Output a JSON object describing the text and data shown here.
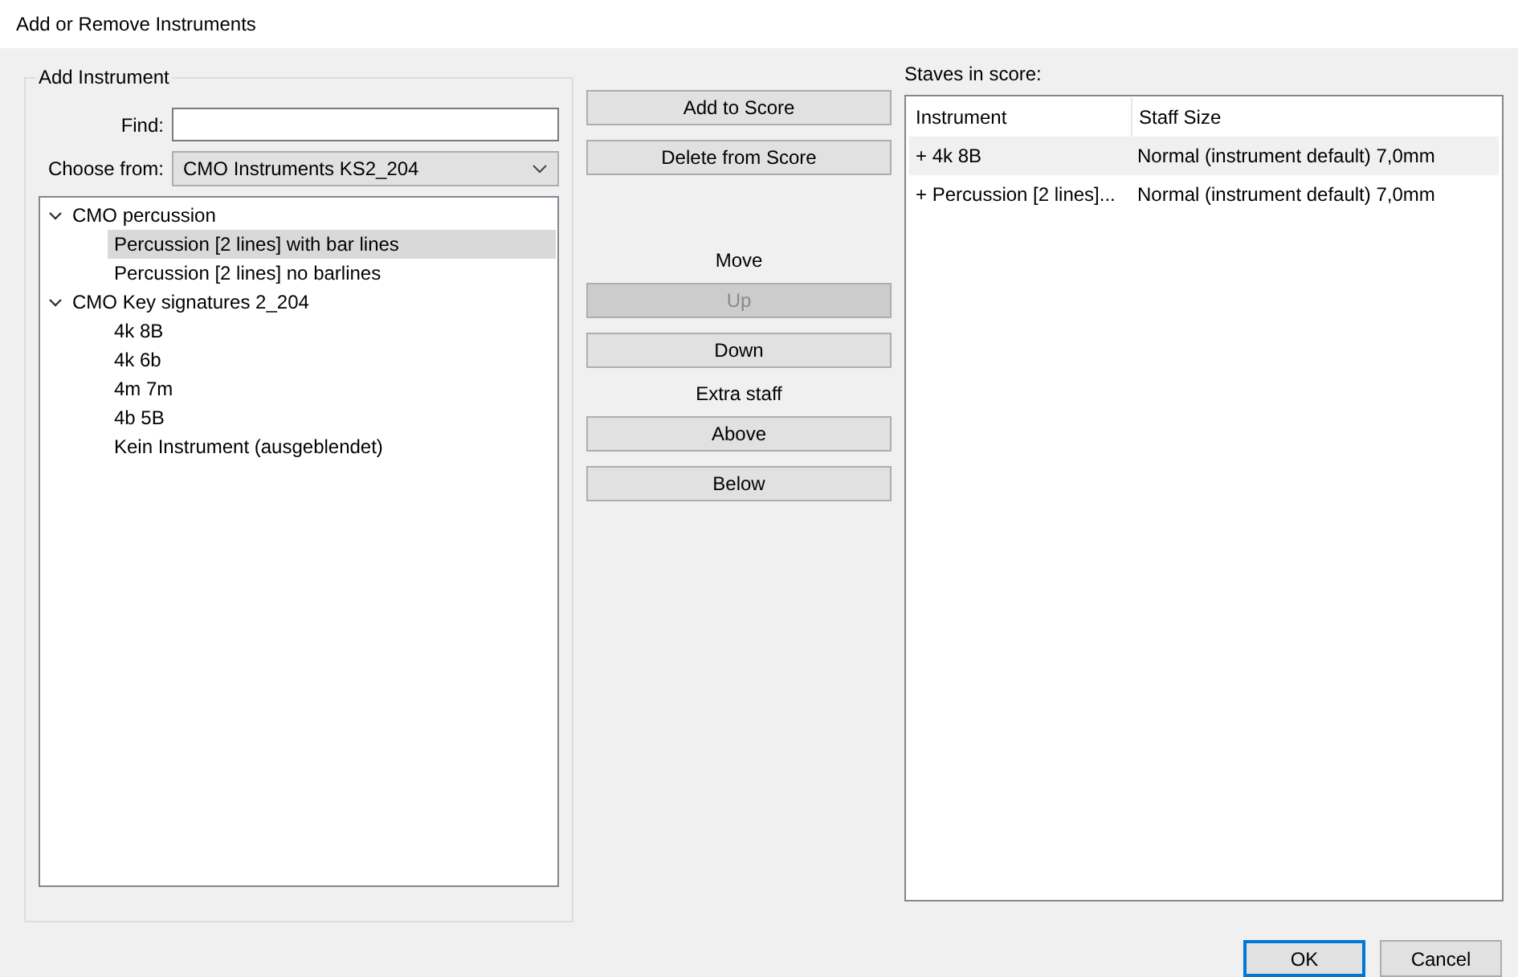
{
  "window": {
    "title": "Add or Remove Instruments"
  },
  "add_instrument": {
    "title": "Add Instrument",
    "find": {
      "label": "Find:"
    },
    "choose_from": {
      "label": "Choose from:",
      "value": "CMO Instruments KS2_204"
    },
    "tree": [
      {
        "label": "CMO percussion",
        "expanded": true,
        "children": [
          {
            "label": "Percussion [2 lines] with bar lines",
            "selected": true
          },
          {
            "label": "Percussion [2 lines] no barlines",
            "selected": false
          }
        ]
      },
      {
        "label": "CMO Key signatures 2_204",
        "expanded": true,
        "children": [
          {
            "label": "4k 8B",
            "selected": false
          },
          {
            "label": "4k 6b",
            "selected": false
          },
          {
            "label": "4m 7m",
            "selected": false
          },
          {
            "label": "4b 5B",
            "selected": false
          },
          {
            "label": "Kein Instrument (ausgeblendet)",
            "selected": false
          }
        ]
      }
    ]
  },
  "actions": [
    {
      "kind": "button",
      "label": "Add to Score",
      "disabled": false
    },
    {
      "kind": "button",
      "label": "Delete from Score",
      "disabled": false
    },
    {
      "kind": "heading",
      "label": "Move"
    },
    {
      "kind": "button",
      "label": "Up",
      "disabled": true
    },
    {
      "kind": "button",
      "label": "Down",
      "disabled": false
    },
    {
      "kind": "heading",
      "label": "Extra staff"
    },
    {
      "kind": "button",
      "label": "Above",
      "disabled": false
    },
    {
      "kind": "button",
      "label": "Below",
      "disabled": false
    }
  ],
  "staves": {
    "label": "Staves in score:",
    "columns": [
      "Instrument",
      "Staff Size"
    ],
    "rows": [
      {
        "instrument": "+ 4k 8B",
        "staff_size": "Normal (instrument default) 7,0mm",
        "selected": true
      },
      {
        "instrument": "+ Percussion [2 lines]...",
        "staff_size": "Normal (instrument default) 7,0mm",
        "selected": false
      }
    ]
  },
  "buttons": [
    {
      "label": "OK",
      "default": true
    },
    {
      "label": "Cancel",
      "default": false
    }
  ]
}
